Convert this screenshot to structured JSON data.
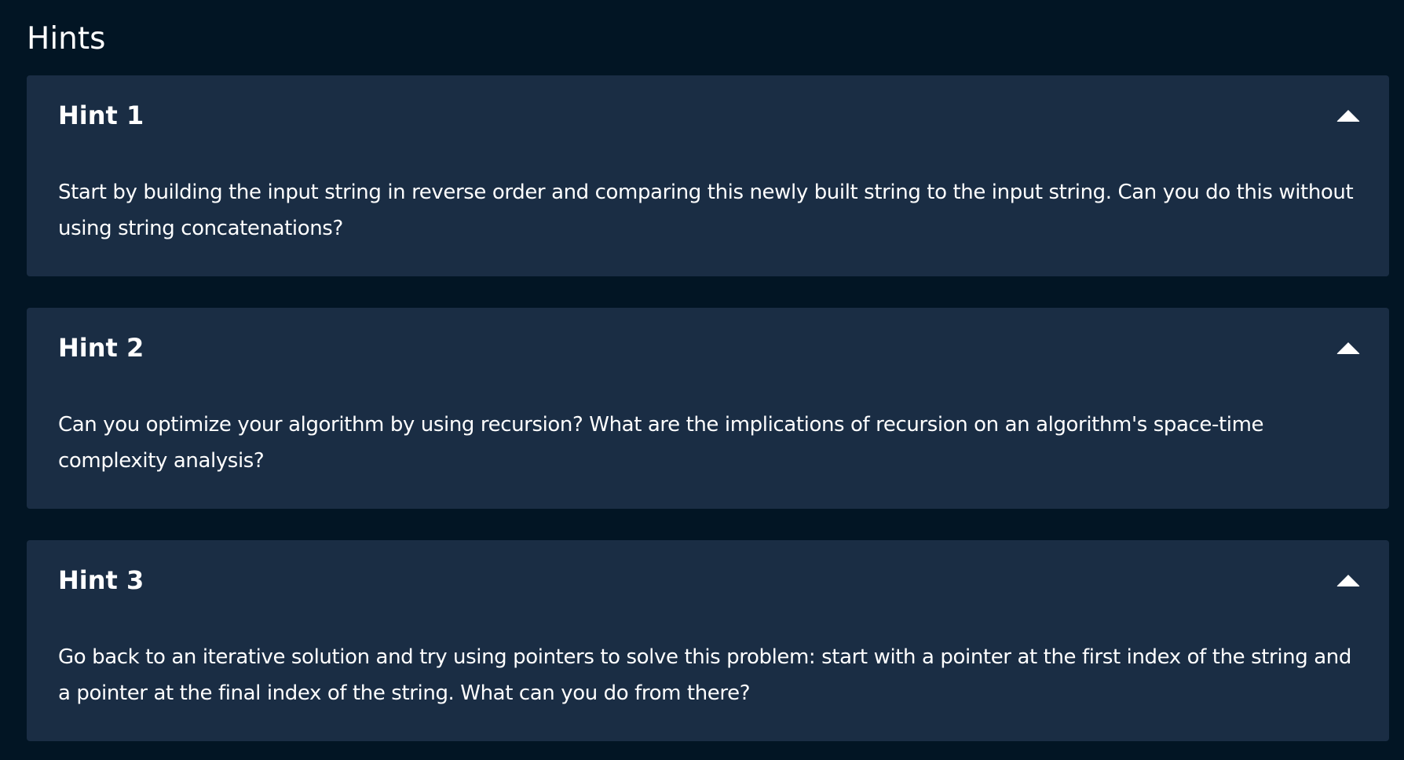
{
  "section": {
    "title": "Hints"
  },
  "hints": [
    {
      "title": "Hint 1",
      "body": "Start by building the input string in reverse order and comparing this newly built string to the input string. Can you do this without using string concatenations?",
      "expanded_icon": "chevron-up-icon"
    },
    {
      "title": "Hint 2",
      "body": "Can you optimize your algorithm by using recursion? What are the implications of recursion on an algorithm's space-time complexity analysis?",
      "expanded_icon": "chevron-up-icon"
    },
    {
      "title": "Hint 3",
      "body": "Go back to an iterative solution and try using pointers to solve this problem: start with a pointer at the first index of the string and a pointer at the final index of the string. What can you do from there?",
      "expanded_icon": "chevron-up-icon"
    }
  ],
  "colors": {
    "background": "#021524",
    "card": "#1a2d44",
    "text": "#ffffff"
  }
}
